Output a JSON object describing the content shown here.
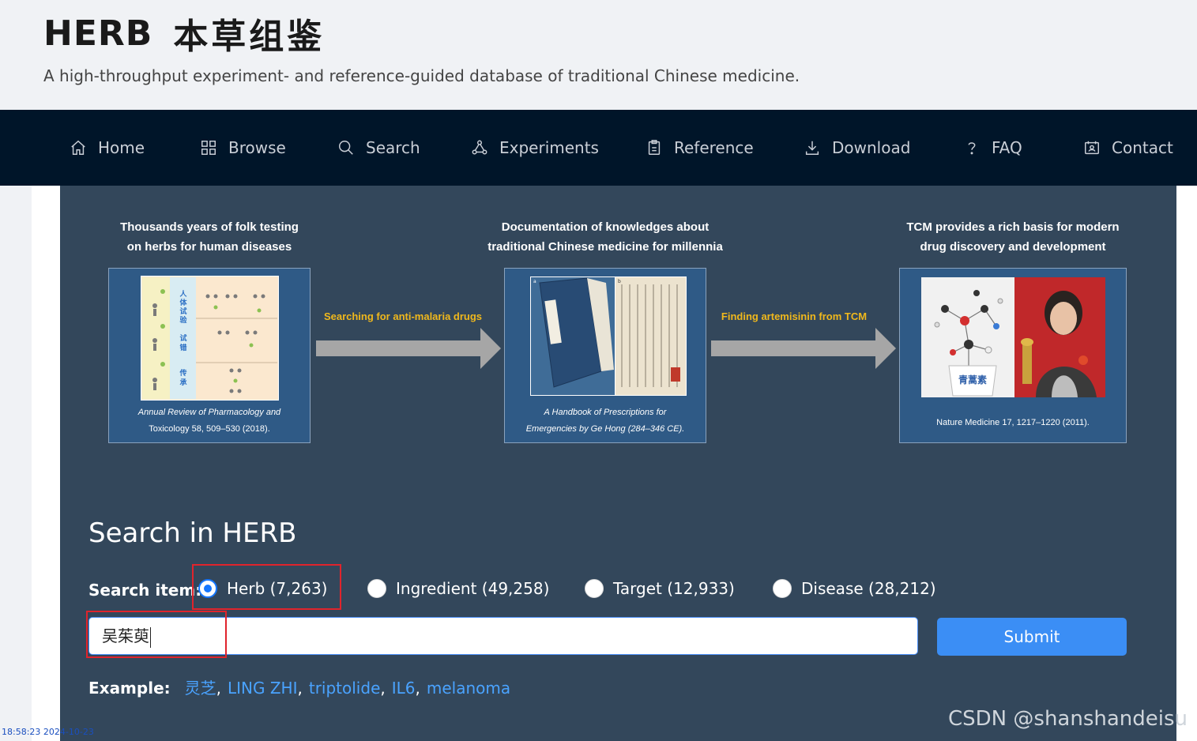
{
  "header": {
    "logo_en": "HERB",
    "logo_cn": "本草组鉴",
    "tagline": "A high-throughput experiment- and reference-guided database of traditional Chinese medicine."
  },
  "nav": [
    {
      "label": "Home",
      "icon": "home-icon"
    },
    {
      "label": "Browse",
      "icon": "grid-icon"
    },
    {
      "label": "Search",
      "icon": "search-icon"
    },
    {
      "label": "Experiments",
      "icon": "experiment-icon"
    },
    {
      "label": "Reference",
      "icon": "reference-icon"
    },
    {
      "label": "Download",
      "icon": "download-icon"
    },
    {
      "label": "FAQ",
      "icon": "question-icon"
    },
    {
      "label": "Contact",
      "icon": "contact-icon"
    }
  ],
  "banner": {
    "panels": [
      {
        "title_line1": "Thousands years of folk testing",
        "title_line2": "on herbs for human diseases",
        "cap_line1": "Annual Review of Pharmacology and",
        "cap_line2": "Toxicology 58, 509–530 (2018)."
      },
      {
        "title_line1": "Documentation of knowledges about",
        "title_line2": "traditional Chinese medicine for millennia",
        "cap_line1": "A Handbook of Prescriptions for",
        "cap_line2": "Emergencies by Ge Hong (284–346 CE)."
      },
      {
        "title_line1": "TCM provides a rich basis for modern",
        "title_line2": "drug discovery and development",
        "cap_line1": "Nature Medicine 17, 1217–1220 (2011).",
        "cap_line2": ""
      }
    ],
    "arrows": [
      {
        "label": "Searching for anti-malaria drugs"
      },
      {
        "label": "Finding artemisinin from TCM"
      }
    ],
    "figure1": {
      "col1": "人体试验",
      "col2": "试错",
      "col3": "传承"
    },
    "figure3": {
      "label": "青蒿素"
    }
  },
  "search": {
    "title": "Search in HERB",
    "item_label": "Search item:",
    "options": [
      {
        "label": "Herb (7,263)",
        "checked": true
      },
      {
        "label": "Ingredient (49,258)",
        "checked": false
      },
      {
        "label": "Target (12,933)",
        "checked": false
      },
      {
        "label": "Disease (28,212)",
        "checked": false
      }
    ],
    "input_value": "吴茱萸",
    "submit_label": "Submit",
    "example_label": "Example:",
    "examples": [
      "灵芝",
      "LING ZHI",
      "triptolide",
      "IL6",
      "melanoma"
    ]
  },
  "watermark": "CSDN @shanshandeisu",
  "timestamp": "18:58:23 2024-10-23"
}
